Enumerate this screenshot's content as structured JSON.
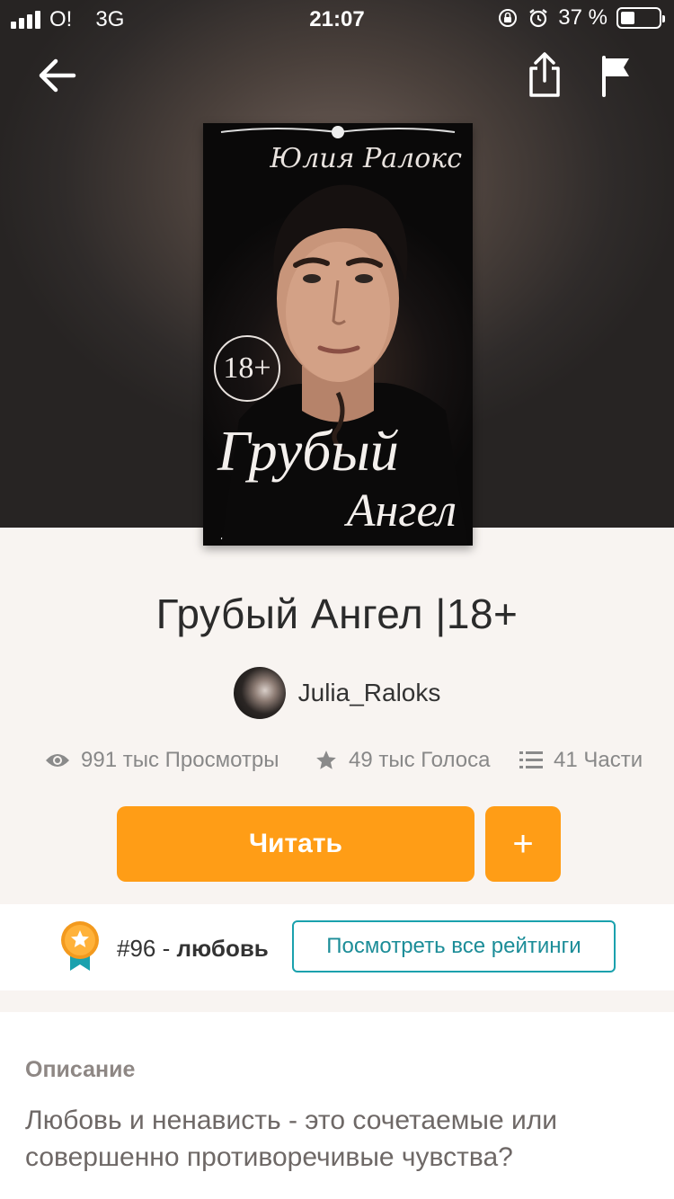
{
  "status_bar": {
    "carrier": "O!",
    "network": "3G",
    "time": "21:07",
    "battery": "37 %",
    "battery_level": 0.37
  },
  "nav": {
    "back_icon": "arrow-left-icon",
    "share_icon": "share-icon",
    "report_icon": "flag-icon"
  },
  "cover": {
    "author": "Юлия Ралокс",
    "age_badge": "18+",
    "title_line1": "Грубый",
    "title_line2": "Ангел"
  },
  "book": {
    "title": "Грубый Ангел |18+",
    "author": "Julia_Raloks"
  },
  "stats": {
    "views": "991 тыс Просмотры",
    "votes": "49 тыс Голоса",
    "parts": "41 Части"
  },
  "actions": {
    "read_label": "Читать",
    "add_label": "+"
  },
  "ranking": {
    "rank": "#96 -",
    "category": "любовь",
    "view_all_label": "Посмотреть все рейтинги"
  },
  "description": {
    "heading": "Описание",
    "text": "Любовь и ненависть - это сочетаемые или совершенно противоречивые чувства?"
  },
  "colors": {
    "accent": "#ff9d16",
    "teal": "#1aa1ad",
    "background": "#f8f4f1"
  }
}
